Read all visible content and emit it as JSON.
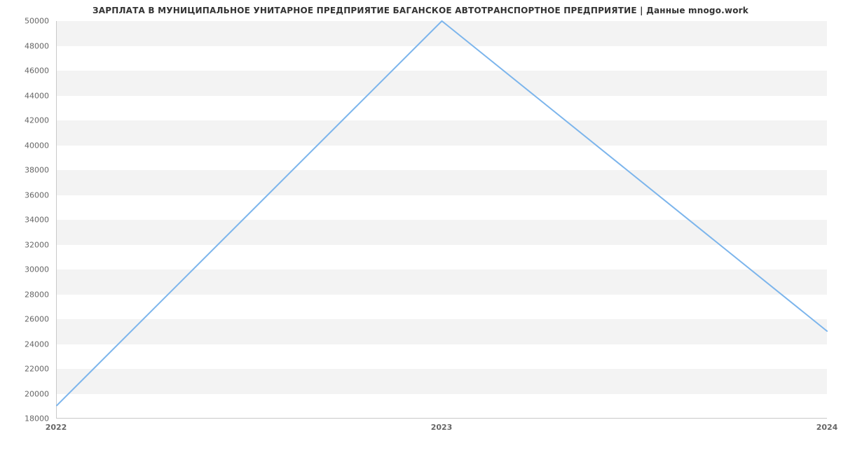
{
  "chart_data": {
    "type": "line",
    "title": "ЗАРПЛАТА В МУНИЦИПАЛЬНОЕ УНИТАРНОЕ ПРЕДПРИЯТИЕ БАГАНСКОЕ АВТОТРАНСПОРТНОЕ ПРЕДПРИЯТИЕ | Данные mnogo.work",
    "xlabel": "",
    "ylabel": "",
    "categories": [
      "2022",
      "2023",
      "2024"
    ],
    "values": [
      19000,
      50000,
      25000
    ],
    "ylim": [
      18000,
      50000
    ],
    "y_ticks": [
      18000,
      20000,
      22000,
      24000,
      26000,
      28000,
      30000,
      32000,
      34000,
      36000,
      38000,
      40000,
      42000,
      44000,
      46000,
      48000,
      50000
    ],
    "colors": {
      "line": "#7cb5ec",
      "band": "#f3f3f3",
      "axis": "#c9c9c9",
      "text": "#333333",
      "tick_text": "#666666"
    }
  }
}
